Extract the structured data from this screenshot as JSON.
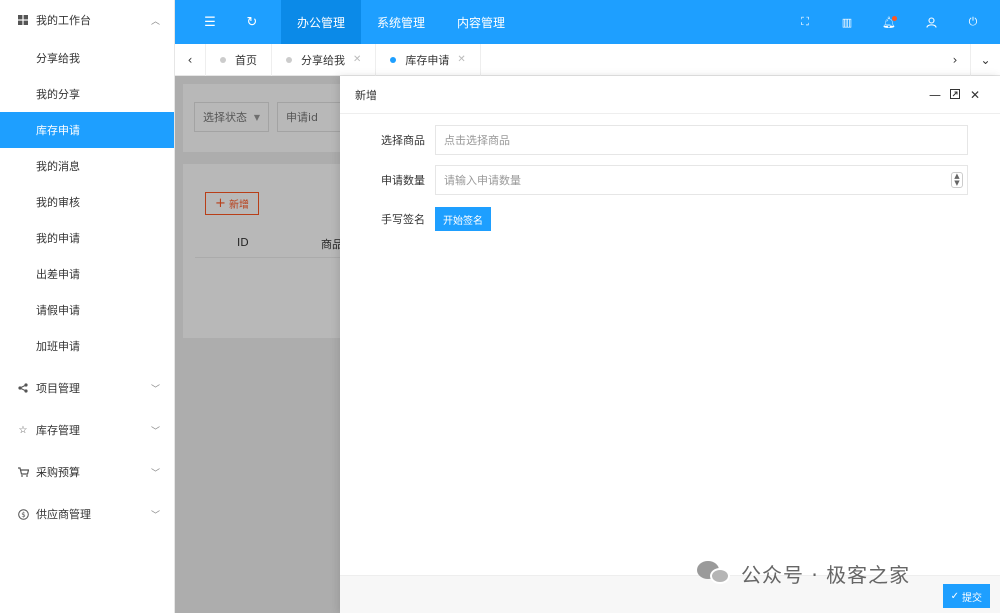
{
  "sidebar": {
    "workbench": {
      "label": "我的工作台",
      "icon": "windows-icon"
    },
    "items": [
      {
        "label": "分享给我"
      },
      {
        "label": "我的分享"
      },
      {
        "label": "库存申请",
        "active": true
      },
      {
        "label": "我的消息"
      },
      {
        "label": "我的审核"
      },
      {
        "label": "我的申请"
      },
      {
        "label": "出差申请"
      },
      {
        "label": "请假申请"
      },
      {
        "label": "加班申请"
      }
    ],
    "groups": [
      {
        "label": "项目管理",
        "icon": "share-icon"
      },
      {
        "label": "库存管理",
        "icon": "star-half-icon"
      },
      {
        "label": "采购预算",
        "icon": "cart-icon"
      },
      {
        "label": "供应商管理",
        "icon": "dollar-icon"
      }
    ]
  },
  "topbar": {
    "menus": [
      "办公管理",
      "系统管理",
      "内容管理"
    ],
    "active_menu": "办公管理",
    "accent_color": "#1e9fff"
  },
  "tabs": [
    {
      "label": "首页"
    },
    {
      "label": "分享给我"
    },
    {
      "label": "库存申请",
      "active": true
    }
  ],
  "background": {
    "filter_status_placeholder": "选择状态",
    "filter_id_placeholder": "申请id",
    "add_button_label": "新增",
    "table_headers": [
      "ID",
      "商品"
    ]
  },
  "drawer": {
    "title": "新增",
    "fields": {
      "product_label": "选择商品",
      "product_placeholder": "点击选择商品",
      "quantity_label": "申请数量",
      "quantity_placeholder": "请输入申请数量",
      "signature_label": "手写签名",
      "signature_button": "开始签名"
    },
    "submit_label": "提交"
  },
  "watermark": {
    "text": "公众号 · 极客之家"
  }
}
